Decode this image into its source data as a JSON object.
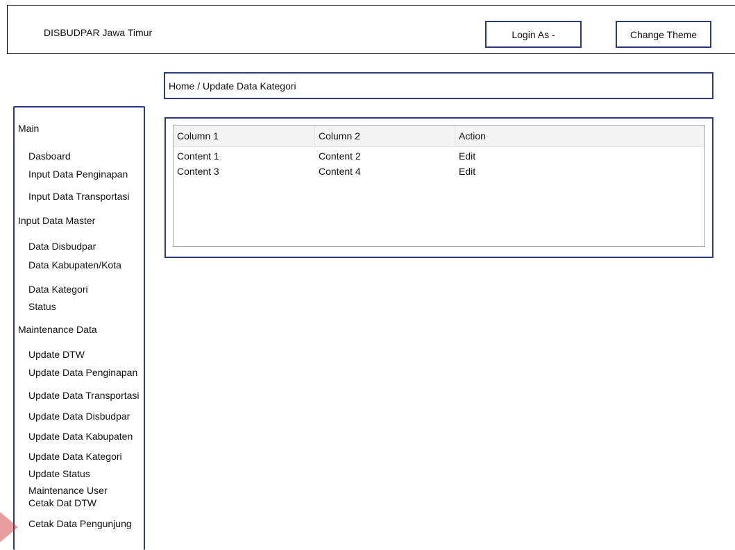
{
  "header": {
    "app_title": "DISBUDPAR Jawa Timur",
    "login_label": "Login As -",
    "theme_label": "Change Theme"
  },
  "breadcrumb": "Home / Update Data Kategori",
  "sidebar": {
    "main_title": "Main",
    "main_items": [
      "Dasboard",
      "Input Data Penginapan",
      "Input Data Transportasi"
    ],
    "master_title": "Input Data Master",
    "master_items": [
      "Data Disbudpar",
      "Data Kabupaten/Kota",
      "Data Kategori",
      "Status"
    ],
    "maintenance_title": "Maintenance Data",
    "maintenance_items": [
      "Update DTW",
      "Update Data Penginapan",
      "Update Data Transportasi",
      "Update Data Disbudpar",
      "Update Data Kabupaten",
      "Update Data Kategori",
      "Update Status",
      "Maintenance User",
      "Cetak Dat DTW",
      "Cetak Data Pengunjung"
    ]
  },
  "table": {
    "columns": [
      "Column 1",
      "Column 2",
      "Action"
    ],
    "rows": [
      [
        "Content 1",
        "Content 2",
        "Edit"
      ],
      [
        "Content 3",
        "Content 4",
        "Edit"
      ]
    ]
  },
  "colors": {
    "accent_border": "#2a3a7a"
  }
}
